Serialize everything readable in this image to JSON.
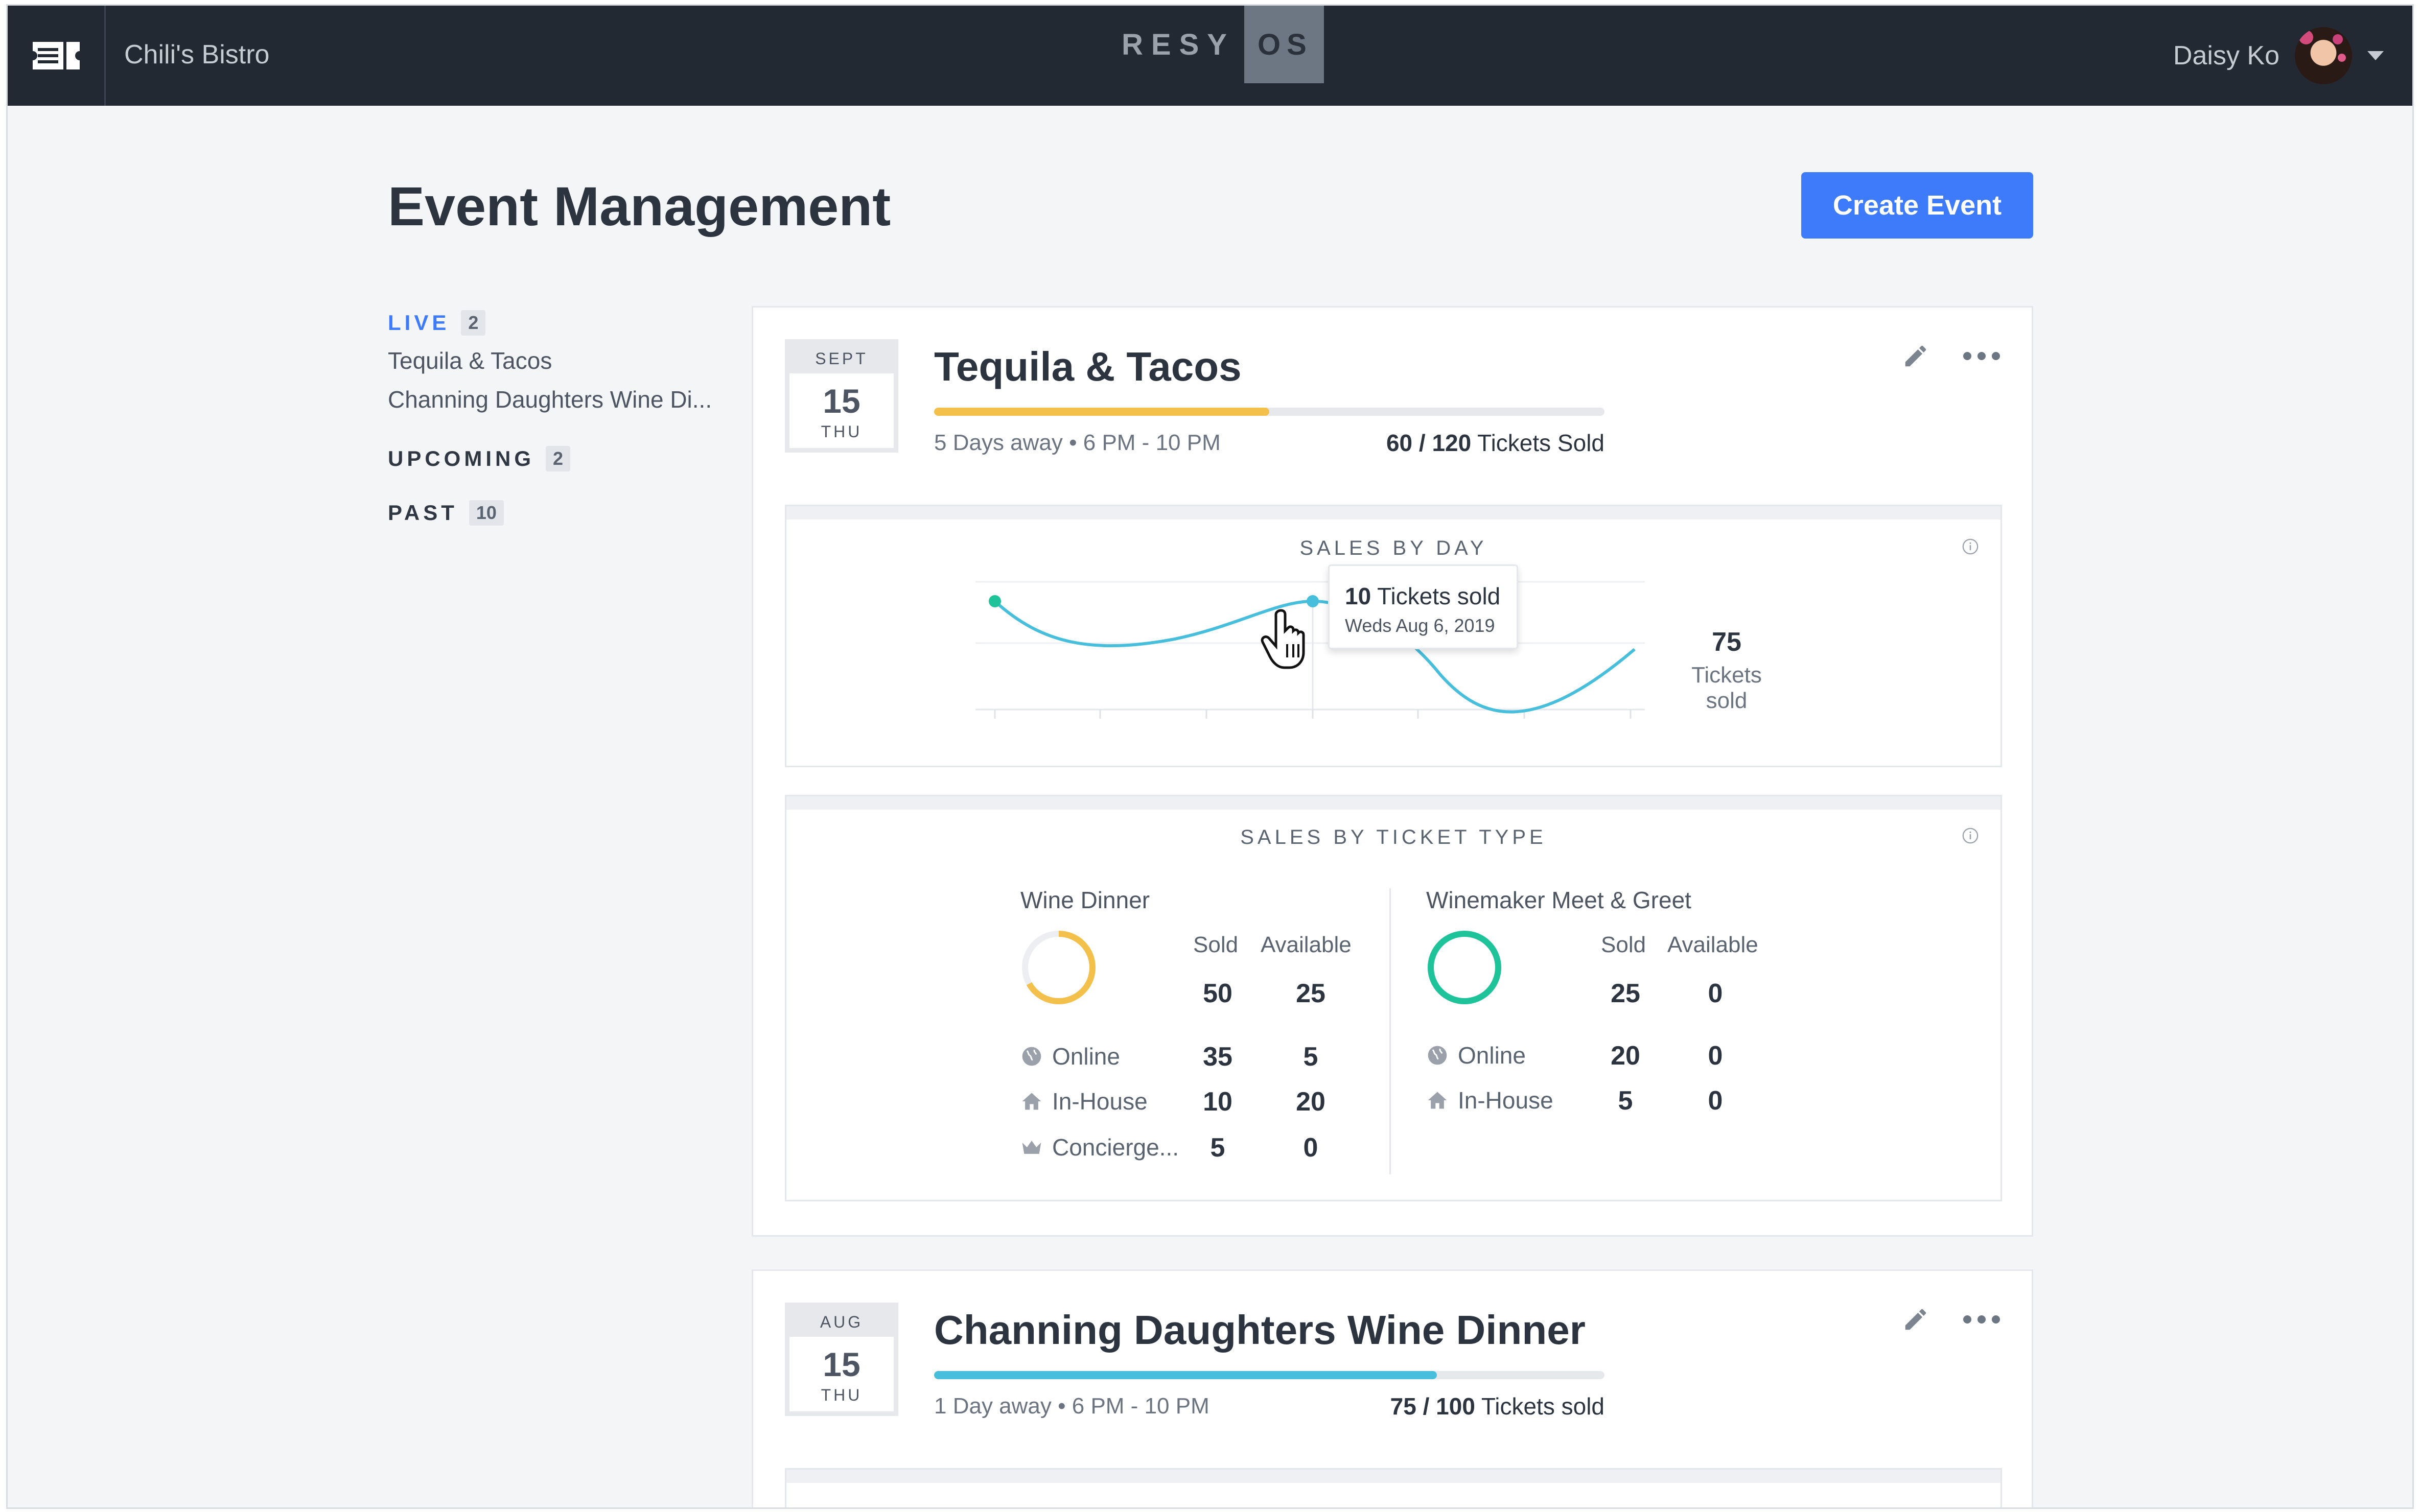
{
  "topbar": {
    "venue": "Chili's Bistro",
    "logo_left": "RESY",
    "logo_right": "OS",
    "user_name": "Daisy Ko"
  },
  "header": {
    "title": "Event Management",
    "create_label": "Create Event"
  },
  "sidebar": {
    "live": {
      "label": "LIVE",
      "count": "2",
      "items": [
        "Tequila & Tacos",
        "Channing Daughters Wine Di..."
      ]
    },
    "upcoming": {
      "label": "UPCOMING",
      "count": "2"
    },
    "past": {
      "label": "PAST",
      "count": "10"
    }
  },
  "events": [
    {
      "month": "SEPT",
      "day": "15",
      "dow": "THU",
      "title": "Tequila & Tacos",
      "progress": 0.5,
      "progress_color": "#f3c14b",
      "meta_away": "5 Days away",
      "meta_time": "6 PM - 10 PM",
      "sold": "60",
      "capacity": "120",
      "tickets_label": "Tickets Sold",
      "sales_by_day": {
        "title": "SALES BY DAY",
        "tooltip_count": "10",
        "tooltip_label": "Tickets sold",
        "tooltip_date": "Weds Aug 6, 2019",
        "total": "75",
        "total_label": "Tickets sold"
      },
      "sales_by_type": {
        "title": "SALES BY TICKET TYPE",
        "sold_label": "Sold",
        "available_label": "Available",
        "types": [
          {
            "name": "Wine Dinner",
            "ring_color": "#f3c14b",
            "ring_fraction": 0.67,
            "sold": "50",
            "available": "25",
            "rows": [
              {
                "icon": "globe-icon",
                "label": "Online",
                "sold": "35",
                "available": "5"
              },
              {
                "icon": "home-icon",
                "label": "In-House",
                "sold": "10",
                "available": "20"
              },
              {
                "icon": "crown-icon",
                "label": "Concierge...",
                "sold": "5",
                "available": "0"
              }
            ]
          },
          {
            "name": "Winemaker Meet & Greet",
            "ring_color": "#1fc39a",
            "ring_fraction": 1.0,
            "sold": "25",
            "available": "0",
            "rows": [
              {
                "icon": "globe-icon",
                "label": "Online",
                "sold": "20",
                "available": "0"
              },
              {
                "icon": "home-icon",
                "label": "In-House",
                "sold": "5",
                "available": "0"
              }
            ]
          }
        ]
      }
    },
    {
      "month": "AUG",
      "day": "15",
      "dow": "THU",
      "title": "Channing Daughters Wine Dinner",
      "progress": 0.75,
      "progress_color": "#47bedb",
      "meta_away": "1 Day away",
      "meta_time": "6 PM - 10 PM",
      "sold": "75",
      "capacity": "100",
      "tickets_label": "Tickets sold"
    }
  ],
  "colors": {
    "accent": "#3d7bfb",
    "topbar": "#232933",
    "line": "#47bedb",
    "point": "#1fc39a"
  }
}
